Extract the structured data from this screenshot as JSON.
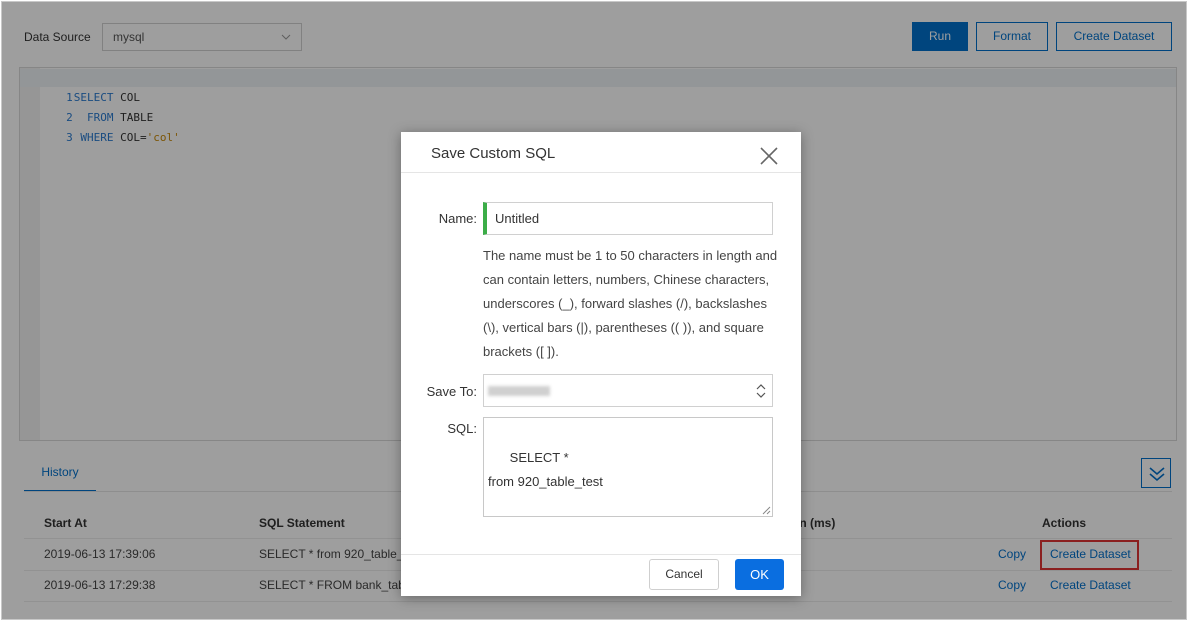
{
  "toolbar": {
    "data_source_label": "Data Source",
    "data_source_value": "mysql",
    "run_label": "Run",
    "format_label": "Format",
    "create_dataset_label": "Create Dataset"
  },
  "editor": {
    "lines": [
      {
        "num": "1",
        "kw": "SELECT",
        "rest": " COL",
        "str": ""
      },
      {
        "num": "2",
        "kw": "  FROM",
        "rest": " TABLE",
        "str": ""
      },
      {
        "num": "3",
        "kw": " WHERE",
        "rest": " COL=",
        "str": "'col'"
      }
    ]
  },
  "history": {
    "tab_label": "History",
    "columns": {
      "start_at": "Start At",
      "sql_statement": "SQL Statement",
      "duration": "on (ms)",
      "actions": "Actions"
    },
    "rows": [
      {
        "start_at": "2019-06-13 17:39:06",
        "sql": "SELECT * from 920_table_te",
        "copy": "Copy",
        "create": "Create Dataset"
      },
      {
        "start_at": "2019-06-13 17:29:38",
        "sql": "SELECT * FROM bank_table",
        "copy": "Copy",
        "create": "Create Dataset"
      }
    ]
  },
  "modal": {
    "title": "Save Custom SQL",
    "name_label": "Name:",
    "name_value": "Untitled",
    "hint": "The name must be 1 to 50 characters in length and can contain letters, numbers, Chinese characters, underscores (_), forward slashes (/), backslashes (\\), vertical bars (|), parentheses (( )), and square brackets ([ ]).",
    "save_to_label": "Save To:",
    "sql_label": "SQL:",
    "sql_value": "SELECT *\nfrom 920_table_test",
    "cancel_label": "Cancel",
    "ok_label": "OK"
  },
  "colors": {
    "primary": "#0070cc",
    "ok_button": "#0a6ee0",
    "name_indicator": "#3cad48",
    "highlight": "#e03434"
  },
  "icons": {
    "close": "close-icon",
    "collapse": "double-chevron-down-icon",
    "select": "chevron-down-icon",
    "updown": "updown-chevron-icon"
  }
}
